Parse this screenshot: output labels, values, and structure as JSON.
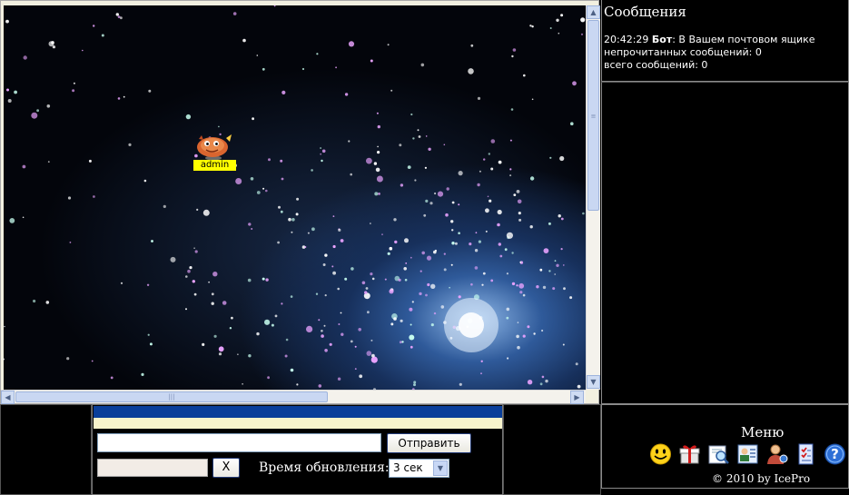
{
  "map": {
    "avatar_name": "admin"
  },
  "messages": {
    "title": "Сообщения",
    "time": "20:42:29",
    "sender": "Бот",
    "text_line1": ": В Вашем почтовом ящике",
    "text_line2": "непрочитанных сообщений: 0",
    "text_line3": "всего сообщений: 0"
  },
  "chat": {
    "message_value": "",
    "send_label": "Отправить",
    "clear_label": "X",
    "refresh_label": "Время обновления:",
    "refresh_value": "3 сек"
  },
  "menu": {
    "title": "Меню",
    "icons": [
      "smiley-icon",
      "gift-box-icon",
      "search-document-icon",
      "user-card-icon",
      "user-profile-icon",
      "checklist-icon",
      "help-icon"
    ],
    "copyright": "© 2010 by IcePro"
  }
}
